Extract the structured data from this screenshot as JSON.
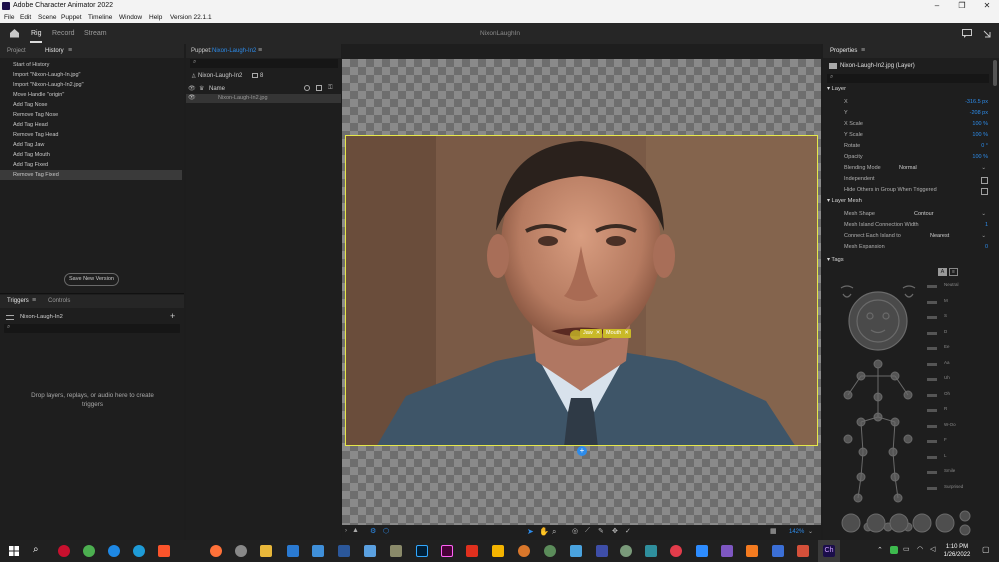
{
  "window": {
    "title": "Adobe Character Animator 2022"
  },
  "menu": [
    "File",
    "Edit",
    "Scene",
    "Puppet",
    "Timeline",
    "Window",
    "Help",
    "Version 22.1.1"
  ],
  "workspace": {
    "tabs": [
      "Rig",
      "Record",
      "Stream"
    ],
    "active": "Rig",
    "center_title": "NixonLaughIn"
  },
  "left": {
    "tabs": [
      "Project",
      "History"
    ],
    "history": [
      "Start of History",
      "Import \"Nixon-Laugh-In.jpg\"",
      "Import \"Nixon-Laugh-In2.jpg\"",
      "Move Handle \"origin\"",
      "Add Tag Nose",
      "Remove Tag Nose",
      "Add Tag Head",
      "Remove Tag Head",
      "Add Tag Jaw",
      "Add Tag Mouth",
      "Add Tag Fixed",
      "Remove Tag Fixed"
    ],
    "save_button": "Save New Version",
    "trigger_tabs": [
      "Triggers",
      "Controls"
    ],
    "trigger_item": "Nixon-Laugh-In2",
    "drop_hint": "Drop layers, replays, or audio here to create triggers"
  },
  "puppet": {
    "header_label": "Puppet:",
    "header_name": "Nixon-Laugh-In2",
    "root_name": "Nixon-Laugh-In2",
    "count": "8",
    "column_name": "Name",
    "layer": "Nixon-Laugh-In2.jpg"
  },
  "scene": {
    "tags": [
      "Jaw",
      "Mouth"
    ],
    "zoom": "142%"
  },
  "properties": {
    "title": "Properties",
    "layer_title": "Nixon-Laugh-In2.jpg (Layer)",
    "sections": {
      "layer": "Layer",
      "mesh": "Layer Mesh",
      "tags": "Tags"
    },
    "layer_props": [
      {
        "label": "X",
        "value": "-316.5 px"
      },
      {
        "label": "Y",
        "value": "-208 px"
      },
      {
        "label": "X Scale",
        "value": "100 %"
      },
      {
        "label": "Y Scale",
        "value": "100 %"
      },
      {
        "label": "Rotate",
        "value": "0 °"
      },
      {
        "label": "Opacity",
        "value": "100 %"
      }
    ],
    "blending": {
      "label": "Blending Mode",
      "value": "Normal"
    },
    "independent": "Independent",
    "hide_others": "Hide Others in Group When Triggered",
    "mesh_shape": {
      "label": "Mesh Shape",
      "value": "Contour"
    },
    "island_width": {
      "label": "Mesh Island Connection Width",
      "value": "1"
    },
    "connect": {
      "label": "Connect Each Island to",
      "value": "Nearest"
    },
    "expansion": {
      "label": "Mesh Expansion",
      "value": "0"
    },
    "visemes": [
      "Neutral",
      "M",
      "S",
      "D",
      "Ee",
      "Aa",
      "Uh",
      "Oh",
      "R",
      "W-Oo",
      "F",
      "L",
      "Smile",
      "Surprised"
    ],
    "tag_toggle": "A"
  },
  "taskbar": {
    "time": "1:10 PM",
    "date": "1/26/2022"
  },
  "colors": {
    "accent": "#2d8ceb",
    "selection": "#e6e84a",
    "tag": "#c9b928"
  }
}
